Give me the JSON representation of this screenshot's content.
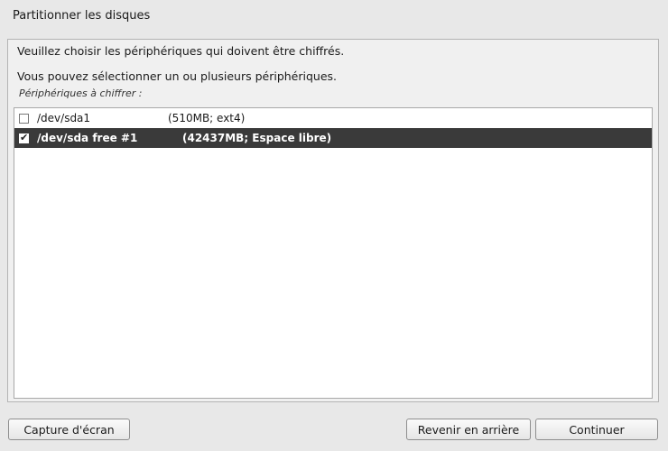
{
  "window": {
    "title": "Partitionner les disques"
  },
  "panel": {
    "instruction": "Veuillez choisir les périphériques qui doivent être chiffrés.",
    "multi_select_hint": "Vous pouvez sélectionner un ou plusieurs périphériques.",
    "list_label": "Périphériques à chiffrer :"
  },
  "devices": [
    {
      "name": "/dev/sda1",
      "info": "(510MB; ext4)",
      "checked": false,
      "selected": false
    },
    {
      "name": "/dev/sda free #1",
      "info": "(42437MB; Espace libre)",
      "checked": true,
      "selected": true
    }
  ],
  "checkmark": "✔",
  "buttons": {
    "screenshot": "Capture d'écran",
    "back": "Revenir en arrière",
    "continue": "Continuer"
  },
  "colors": {
    "selected_row": "#3a3a3a",
    "background": "#e8e8e8"
  }
}
